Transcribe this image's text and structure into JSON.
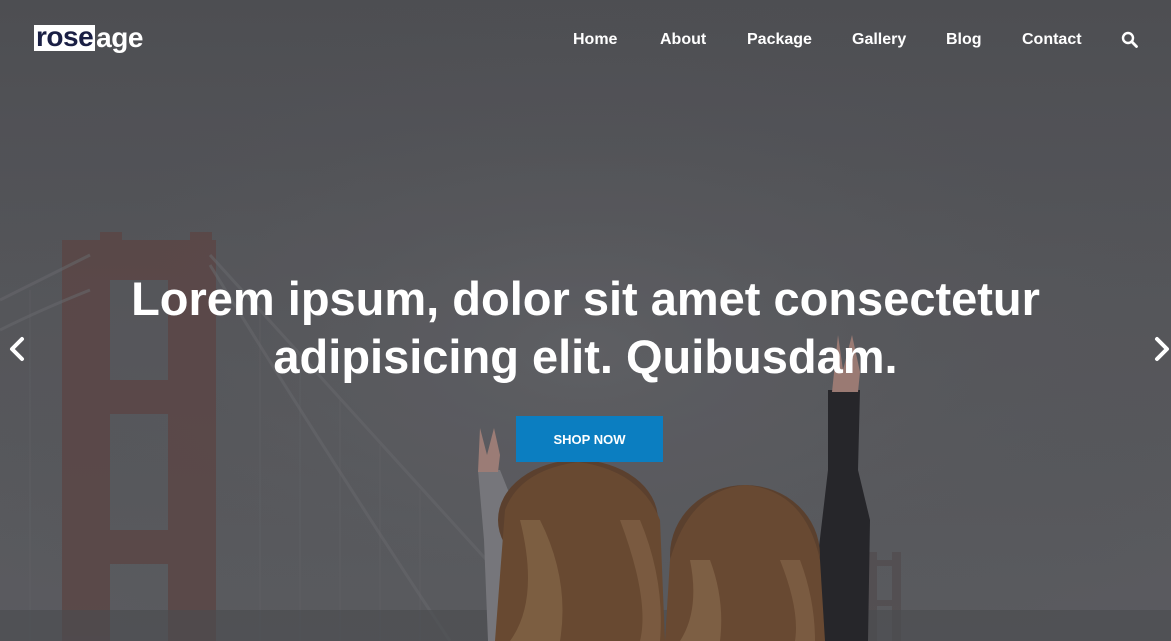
{
  "brand": {
    "logo_part1": "rose",
    "logo_part2": "age"
  },
  "nav": {
    "items": [
      {
        "label": "Home"
      },
      {
        "label": "About"
      },
      {
        "label": "Package"
      },
      {
        "label": "Gallery"
      },
      {
        "label": "Blog"
      },
      {
        "label": "Contact"
      }
    ],
    "search_icon": "search-icon"
  },
  "hero": {
    "headline_line1": "Lorem ipsum, dolor sit amet consectetur",
    "headline_line2": "adipisicing elit. Quibusdam.",
    "cta_label": "SHOP NOW",
    "prev_icon": "chevron-left-icon",
    "next_icon": "chevron-right-icon"
  },
  "colors": {
    "cta": "#0b7ec1",
    "logo_dark": "#1a1f44",
    "text": "#ffffff"
  }
}
